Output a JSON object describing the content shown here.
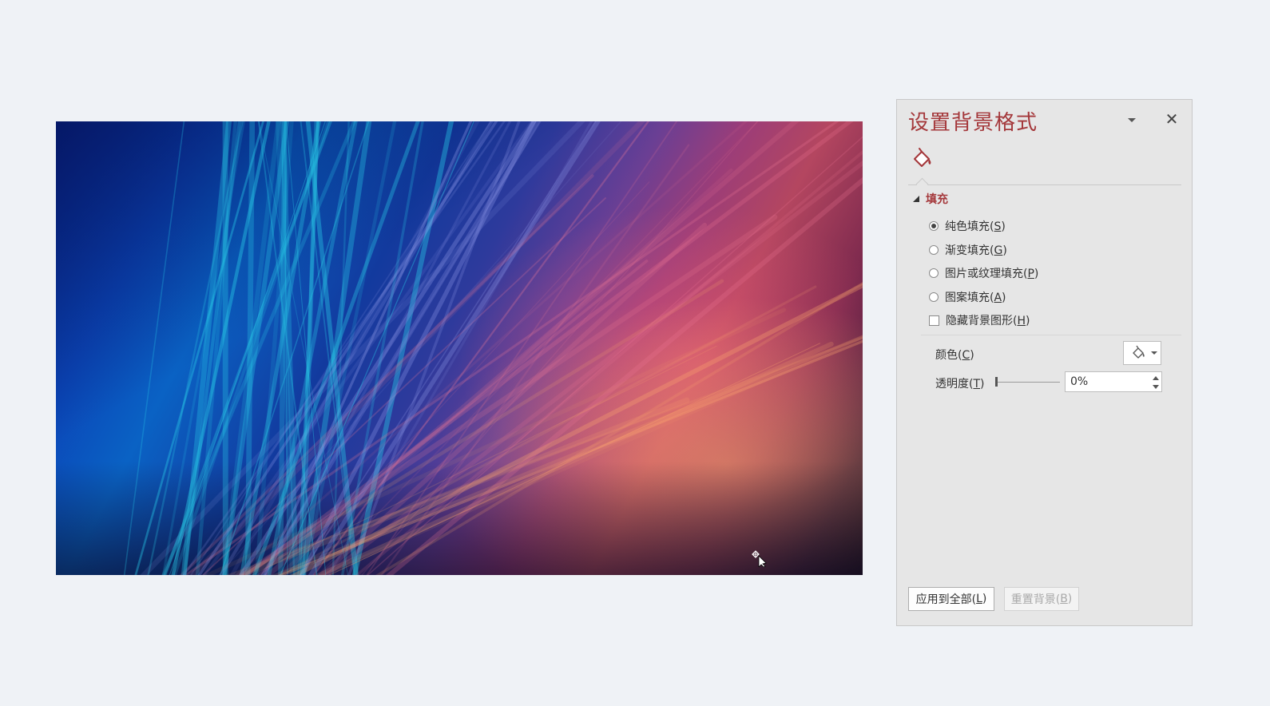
{
  "panel": {
    "title": "设置背景格式",
    "close_glyph": "✕",
    "tab_icon": "paint-bucket-icon",
    "section_title": "填充",
    "options": [
      {
        "label": "纯色填充(",
        "key": "S",
        "suffix": ")",
        "selected": true
      },
      {
        "label": "渐变填充(",
        "key": "G",
        "suffix": ")",
        "selected": false
      },
      {
        "label": "图片或纹理填充(",
        "key": "P",
        "suffix": ")",
        "selected": false
      },
      {
        "label": "图案填充(",
        "key": "A",
        "suffix": ")",
        "selected": false
      }
    ],
    "hide_bg_graphics": {
      "label": "隐藏背景图形(",
      "key": "H",
      "suffix": ")",
      "checked": false
    },
    "color_label": {
      "label": "颜色(",
      "key": "C",
      "suffix": ")"
    },
    "transparency_label": {
      "label": "透明度(",
      "key": "T",
      "suffix": ")"
    },
    "transparency_value": "0%",
    "transparency_level": 0,
    "apply_all": {
      "label": "应用到全部(",
      "key": "L",
      "suffix": ")"
    },
    "reset_bg": {
      "label": "重置背景(",
      "key": "B",
      "suffix": ")",
      "disabled": true
    }
  },
  "colors": {
    "accent": "#a4373a",
    "panel_bg": "#e6e6e6",
    "page_bg": "#eff2f6"
  }
}
